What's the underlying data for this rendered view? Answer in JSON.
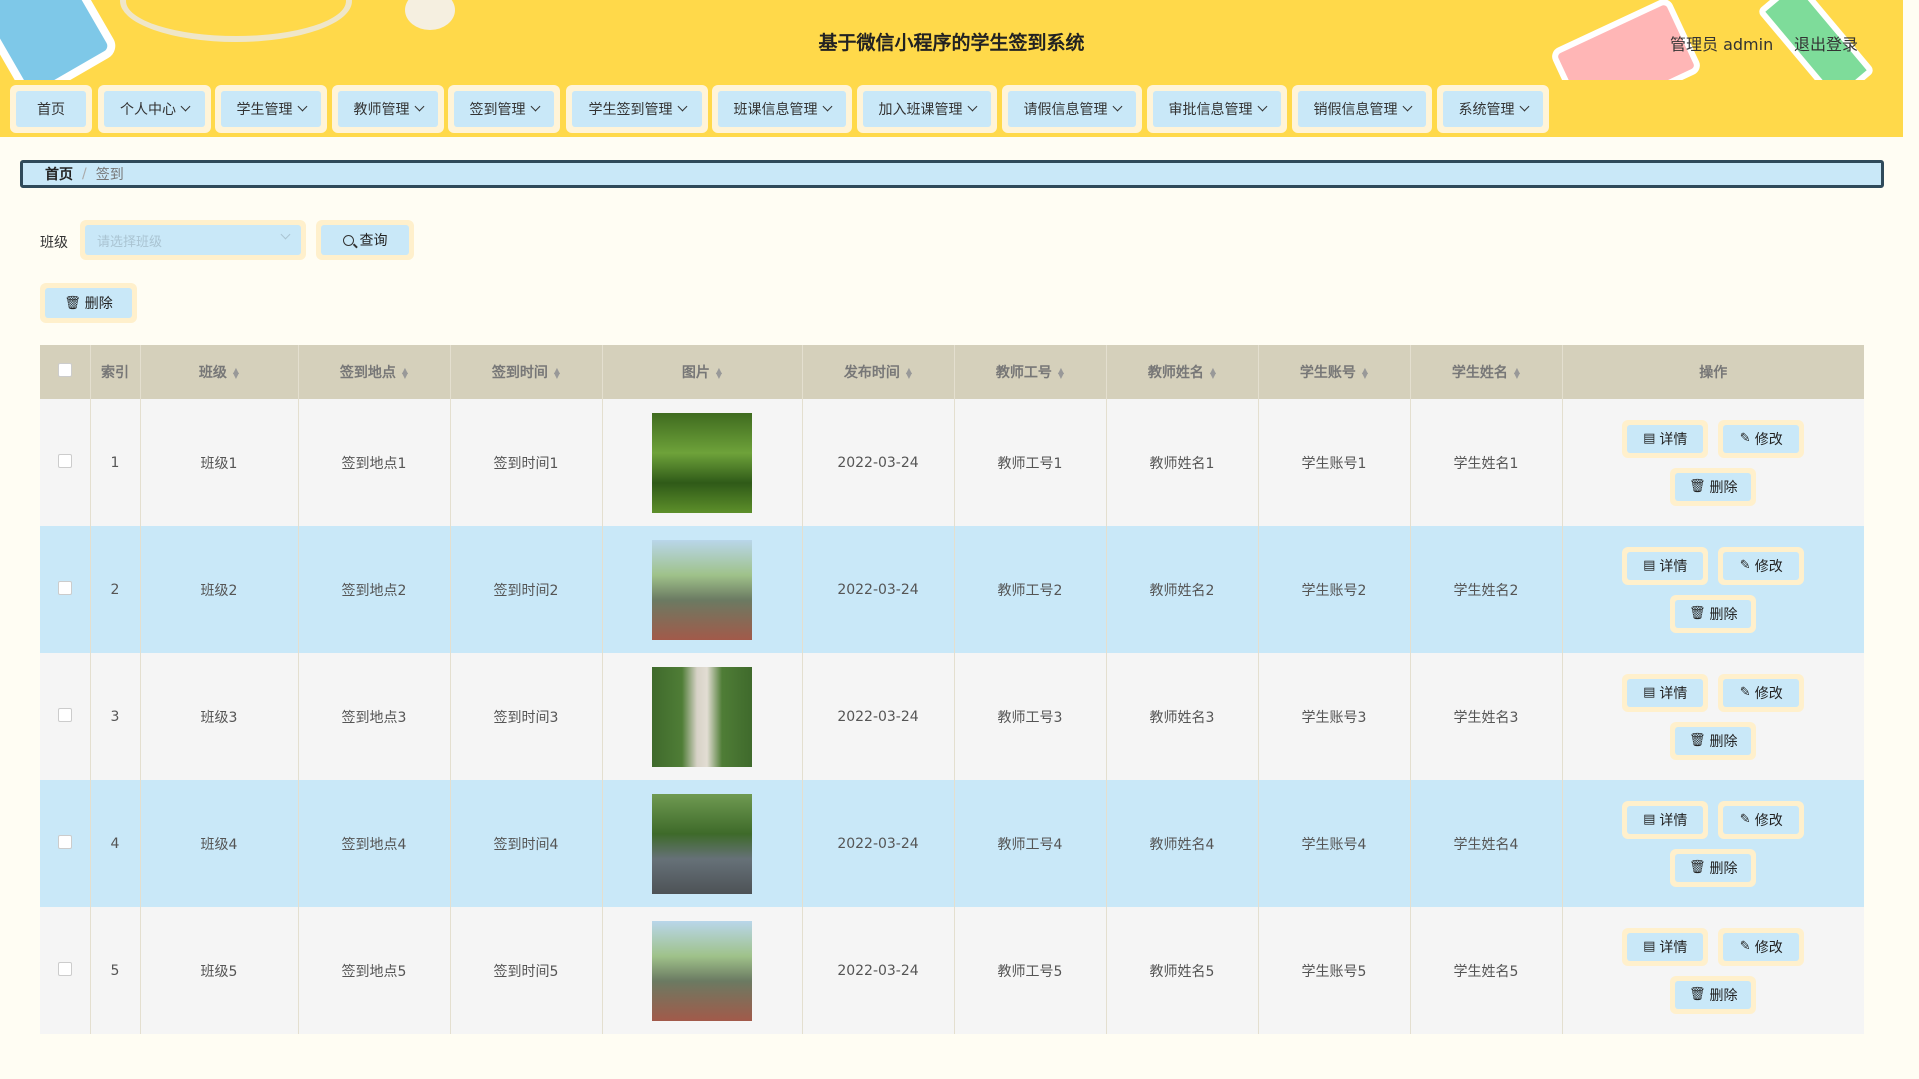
{
  "header": {
    "title": "基于微信小程序的学生签到系统",
    "user_info": "管理员 admin",
    "logout_label": "退出登录"
  },
  "nav": {
    "items": [
      {
        "label": "首页"
      },
      {
        "label": "个人中心"
      },
      {
        "label": "学生管理"
      },
      {
        "label": "教师管理"
      },
      {
        "label": "签到管理"
      },
      {
        "label": "学生签到管理"
      },
      {
        "label": "班课信息管理"
      },
      {
        "label": "加入班课管理"
      },
      {
        "label": "请假信息管理"
      },
      {
        "label": "审批信息管理"
      },
      {
        "label": "销假信息管理"
      },
      {
        "label": "系统管理"
      }
    ]
  },
  "breadcrumb": {
    "home": "首页",
    "separator": "/",
    "current": "签到"
  },
  "search": {
    "class_label": "班级",
    "class_placeholder": "请选择班级",
    "query_label": "查询"
  },
  "toolbar": {
    "delete_label": "删除"
  },
  "table": {
    "columns": [
      "索引",
      "班级",
      "签到地点",
      "签到时间",
      "图片",
      "发布时间",
      "教师工号",
      "教师姓名",
      "学生账号",
      "学生姓名",
      "操作"
    ],
    "actions": {
      "detail": "详情",
      "edit": "修改",
      "delete": "删除"
    },
    "rows": [
      {
        "index": "1",
        "class": "班级1",
        "location": "签到地点1",
        "time": "签到时间1",
        "published": "2022-03-24",
        "teacher_id": "教师工号1",
        "teacher_name": "教师姓名1",
        "student_account": "学生账号1",
        "student_name": "学生姓名1",
        "image": "park-path-photo"
      },
      {
        "index": "2",
        "class": "班级2",
        "location": "签到地点2",
        "time": "签到时间2",
        "published": "2022-03-24",
        "teacher_id": "教师工号2",
        "teacher_name": "教师姓名2",
        "student_account": "学生账号2",
        "student_name": "学生姓名2",
        "image": "plaza-trees-photo"
      },
      {
        "index": "3",
        "class": "班级3",
        "location": "签到地点3",
        "time": "签到时间3",
        "published": "2022-03-24",
        "teacher_id": "教师工号3",
        "teacher_name": "教师姓名3",
        "student_account": "学生账号3",
        "student_name": "学生姓名3",
        "image": "campus-walkway-photo"
      },
      {
        "index": "4",
        "class": "班级4",
        "location": "签到地点4",
        "time": "签到时间4",
        "published": "2022-03-24",
        "teacher_id": "教师工号4",
        "teacher_name": "教师姓名4",
        "student_account": "学生账号4",
        "student_name": "学生姓名4",
        "image": "garden-path-photo"
      },
      {
        "index": "5",
        "class": "班级5",
        "location": "签到地点5",
        "time": "签到时间5",
        "published": "2022-03-24",
        "teacher_id": "教师工号5",
        "teacher_name": "教师姓名5",
        "student_account": "学生账号5",
        "student_name": "学生姓名5",
        "image": "plaza-trees-photo"
      }
    ]
  },
  "colors": {
    "header_bg": "#ffd94a",
    "button_fill": "#c9e8f8",
    "button_border": "#fff0cc",
    "table_header_bg": "#d5d0bb",
    "page_bg": "#fffdf3"
  }
}
